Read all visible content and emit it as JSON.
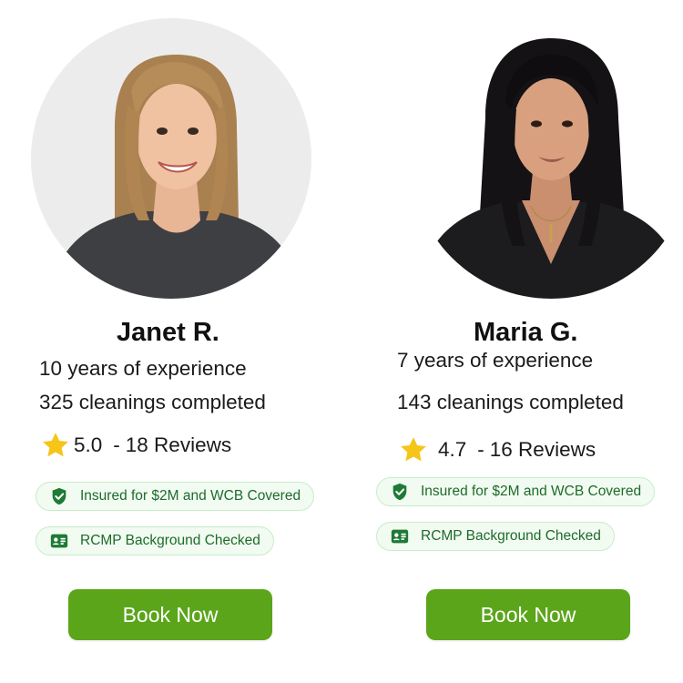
{
  "colors": {
    "accent_button": "#5ba51a",
    "badge_text": "#1e6b2a",
    "badge_bg": "#f1fbf1",
    "badge_border": "#c9ecc9",
    "star": "#f5c518"
  },
  "cleaners": [
    {
      "name": "Janet R.",
      "experience": "10 years of experience",
      "cleanings": "325 cleanings completed",
      "rating": "5.0",
      "reviews": "18 Reviews",
      "badges": [
        {
          "icon": "shield-check-icon",
          "label": "Insured for $2M and WCB Covered"
        },
        {
          "icon": "id-card-icon",
          "label": "RCMP Background Checked"
        }
      ],
      "book_label": "Book Now",
      "photo": "portrait-photo"
    },
    {
      "name": "Maria G.",
      "experience": "7 years of experience",
      "cleanings": "143 cleanings completed",
      "rating": "4.7",
      "reviews": "16 Reviews",
      "badges": [
        {
          "icon": "shield-check-icon",
          "label": "Insured for $2M and WCB Covered"
        },
        {
          "icon": "id-card-icon",
          "label": "RCMP Background Checked"
        }
      ],
      "book_label": "Book Now",
      "photo": "portrait-photo"
    }
  ]
}
